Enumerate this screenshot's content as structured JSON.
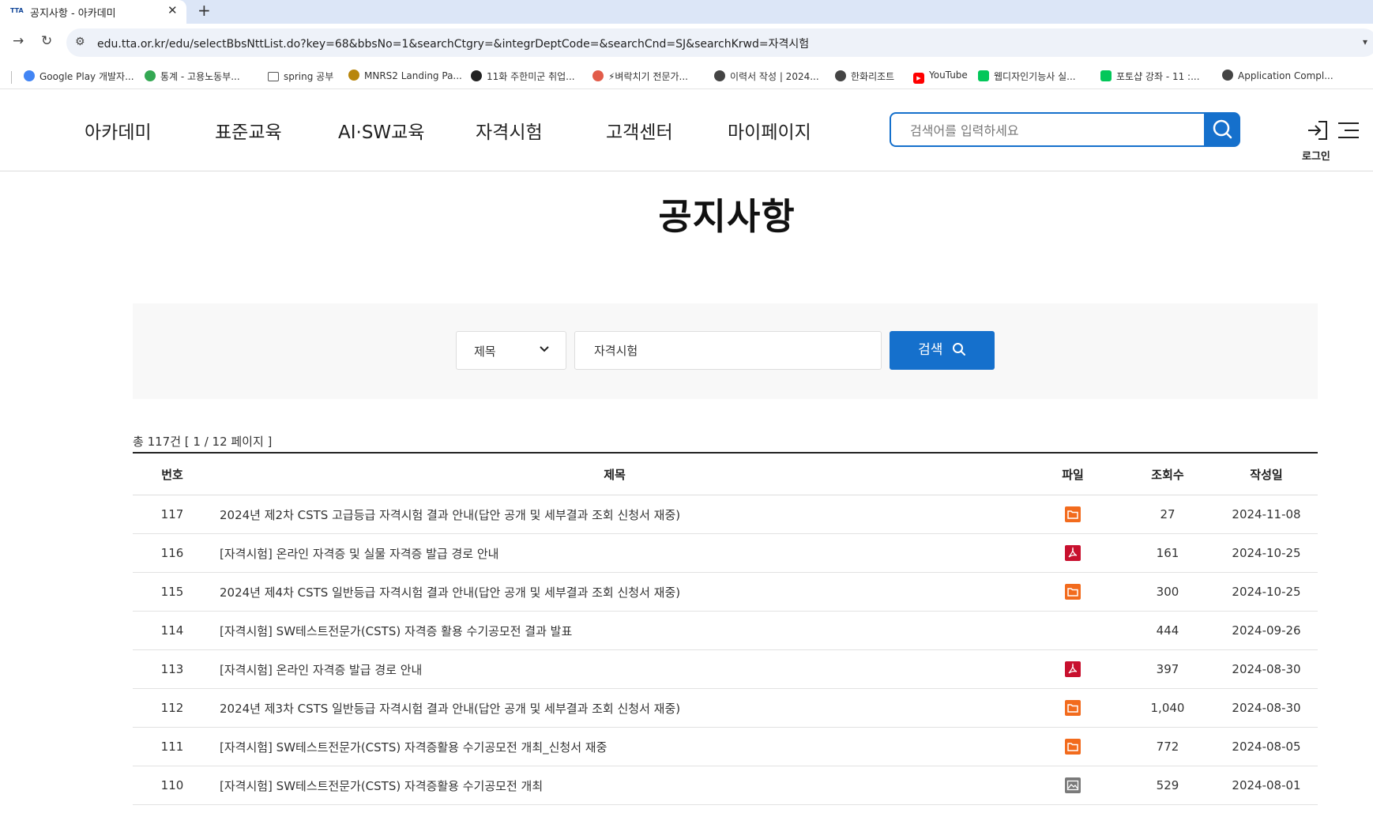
{
  "browser": {
    "tab_title": "공지사항 - 아카데미",
    "tab_favicon": "TTA",
    "url": "edu.tta.or.kr/edu/selectBbsNttList.do?key=68&bbsNo=1&searchCtgry=&integrDeptCode=&searchCnd=SJ&searchKrwd=자격시험",
    "bookmarks": [
      {
        "label": "Google Play 개발자...",
        "icon": "google-icon",
        "color": "#4285f4"
      },
      {
        "label": "통계 - 고용노동부...",
        "icon": "play-icon",
        "color": "#34a853"
      },
      {
        "label": "spring 공부",
        "icon": "folder-icon",
        "color": "#555555"
      },
      {
        "label": "MNRS2 Landing Pa...",
        "icon": "site-icon",
        "color": "#b8860b"
      },
      {
        "label": "11화 주한미군 취업...",
        "icon": "site-icon",
        "color": "#222222"
      },
      {
        "label": "⚡벼락치기 전문가...",
        "icon": "site-icon",
        "color": "#e25c4a"
      },
      {
        "label": "이력서 작성 | 2024...",
        "icon": "globe-icon",
        "color": "#444444"
      },
      {
        "label": "한화리조트",
        "icon": "globe-icon",
        "color": "#444444"
      },
      {
        "label": "YouTube",
        "icon": "youtube-icon",
        "color": "#ff0000"
      },
      {
        "label": "웹디자인기능사 실...",
        "icon": "blog-icon",
        "color": "#03c75a"
      },
      {
        "label": "포토샵 강좌 - 11 :...",
        "icon": "blog-icon",
        "color": "#03c75a"
      },
      {
        "label": "Application Compl...",
        "icon": "globe-icon",
        "color": "#444444"
      }
    ]
  },
  "header": {
    "nav": [
      "아카데미",
      "표준교육",
      "AI·SW교육",
      "자격시험",
      "고객센터",
      "마이페이지"
    ],
    "search_placeholder": "검색어를 입력하세요",
    "login_label": "로그인",
    "accent": "#1570cc"
  },
  "page": {
    "title": "공지사항",
    "search": {
      "select_value": "제목",
      "keyword": "자격시험",
      "button_label": "검색"
    },
    "count_text": "총 117건 [ 1 / 12 페이지 ]",
    "table": {
      "headers": [
        "번호",
        "제목",
        "파일",
        "조회수",
        "작성일"
      ],
      "rows": [
        {
          "no": "117",
          "title": "2024년 제2차 CSTS 고급등급 자격시험 결과 안내(답안 공개 및 세부결과 조회 신청서 재중)",
          "file": "folder",
          "views": "27",
          "date": "2024-11-08"
        },
        {
          "no": "116",
          "title": "[자격시험] 온라인 자격증 및 실물 자격증 발급 경로 안내",
          "file": "pdf",
          "views": "161",
          "date": "2024-10-25"
        },
        {
          "no": "115",
          "title": "2024년 제4차 CSTS 일반등급 자격시험 결과 안내(답안 공개 및 세부결과 조회 신청서 재중)",
          "file": "folder",
          "views": "300",
          "date": "2024-10-25"
        },
        {
          "no": "114",
          "title": "[자격시험] SW테스트전문가(CSTS) 자격증 활용 수기공모전 결과 발표",
          "file": "",
          "views": "444",
          "date": "2024-09-26"
        },
        {
          "no": "113",
          "title": "[자격시험] 온라인 자격증 발급 경로 안내",
          "file": "pdf",
          "views": "397",
          "date": "2024-08-30"
        },
        {
          "no": "112",
          "title": "2024년 제3차 CSTS 일반등급 자격시험 결과 안내(답안 공개 및 세부결과 조회 신청서 재중)",
          "file": "folder",
          "views": "1,040",
          "date": "2024-08-30"
        },
        {
          "no": "111",
          "title": "[자격시험] SW테스트전문가(CSTS) 자격증활용 수기공모전 개최_신청서 재중",
          "file": "folder",
          "views": "772",
          "date": "2024-08-05"
        },
        {
          "no": "110",
          "title": "[자격시험] SW테스트전문가(CSTS) 자격증활용 수기공모전 개최",
          "file": "image",
          "views": "529",
          "date": "2024-08-01"
        }
      ]
    }
  }
}
